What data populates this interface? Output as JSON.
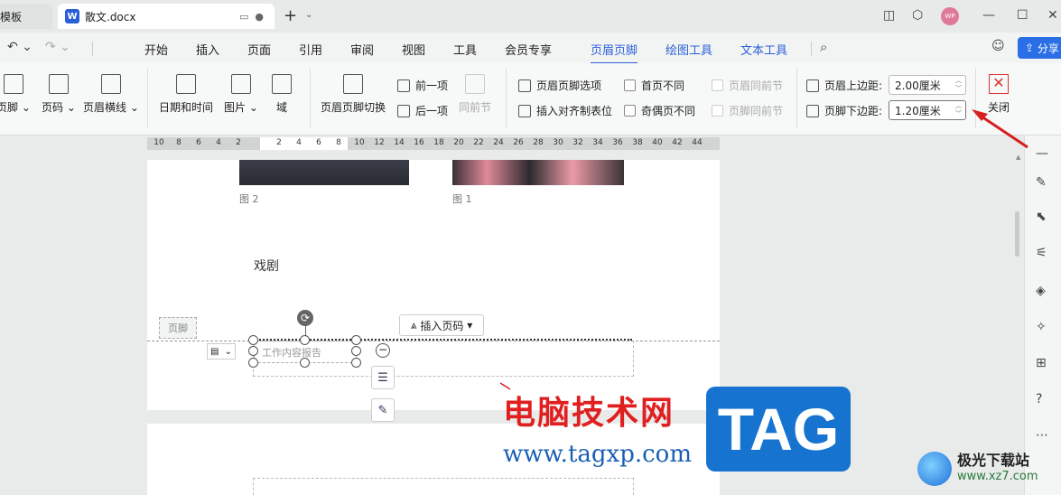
{
  "titlebar": {
    "tab_template": "模板",
    "tab_doc": "散文.docx",
    "doc_icon_letter": "W",
    "avatar_text": "WP"
  },
  "menubar": {
    "items": [
      "开始",
      "插入",
      "页面",
      "引用",
      "审阅",
      "视图",
      "工具",
      "会员专享",
      "页眉页脚",
      "绘图工具",
      "文本工具"
    ],
    "active": "页眉页脚",
    "share": "分享"
  },
  "ribbon": {
    "footer": "页脚",
    "page_number": "页码",
    "header_line": "页眉横线",
    "date_time": "日期和时间",
    "picture": "图片",
    "field": "域",
    "switch_hf": "页眉页脚切换",
    "prev": "前一项",
    "next": "后一项",
    "same_prev_section": "同前节",
    "hf_options": "页眉页脚选项",
    "insert_align_tab": "插入对齐制表位",
    "first_page_diff": "首页不同",
    "odd_even_diff": "奇偶页不同",
    "header_same_prev": "页眉同前节",
    "footer_same_prev": "页脚同前节",
    "header_top_margin_label": "页眉上边距:",
    "header_top_margin_value": "2.00厘米",
    "footer_bottom_margin_label": "页脚下边距:",
    "footer_bottom_margin_value": "1.20厘米",
    "close": "关闭"
  },
  "ruler": [
    "10",
    "8",
    "6",
    "4",
    "2",
    "2",
    "4",
    "6",
    "8",
    "10",
    "12",
    "14",
    "16",
    "18",
    "20",
    "22",
    "24",
    "26",
    "28",
    "30",
    "32",
    "34",
    "36",
    "38",
    "40",
    "42",
    "44"
  ],
  "document": {
    "caption_fig2": "图 2",
    "caption_fig1": "图 1",
    "paragraph": "戏剧",
    "footer_tag": "页脚",
    "insert_page_number": "插入页码",
    "textbox": "工作内容报告"
  },
  "watermarks": {
    "cn_site": "电脑技术网",
    "url": "www.tagxp.com",
    "tag": "TAG",
    "xz_title": "极光下载站",
    "xz_url": "www.xz7.com"
  },
  "colors": {
    "accent": "#2b5fd9",
    "annotation_red": "#d42020"
  }
}
